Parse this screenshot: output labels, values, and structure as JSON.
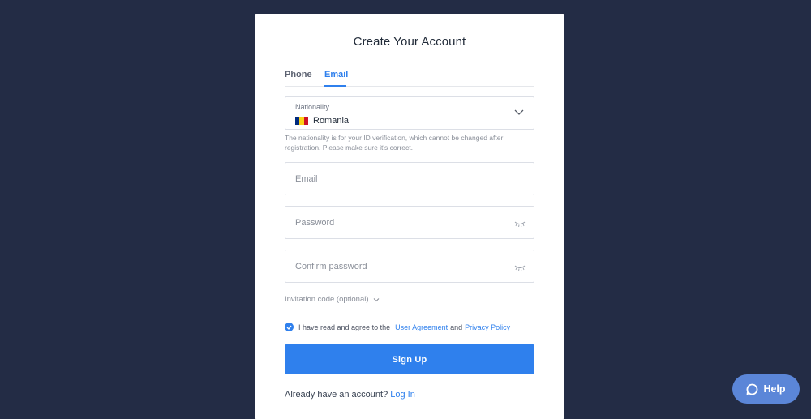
{
  "form": {
    "title": "Create Your Account",
    "tabs": [
      {
        "label": "Phone",
        "active": false
      },
      {
        "label": "Email",
        "active": true
      }
    ],
    "nationality": {
      "label": "Nationality",
      "value": "Romania",
      "flag_colors": [
        "#002b7f",
        "#fcd116",
        "#ce1126"
      ],
      "icon": "chevron-down-icon"
    },
    "nationality_hint": "The nationality is for your ID verification, which cannot be changed after registration. Please make sure it's correct.",
    "email": {
      "placeholder": "Email",
      "value": ""
    },
    "password": {
      "placeholder": "Password",
      "value": "",
      "icon": "eye-closed-icon"
    },
    "confirm_password": {
      "placeholder": "Confirm password",
      "value": "",
      "icon": "eye-closed-icon"
    },
    "invitation_code_label": "Invitation code (optional)",
    "agreement": {
      "checked": true,
      "prefix": "I have read and agree to the",
      "user_agreement": "User Agreement",
      "and": "and",
      "privacy_policy": "Privacy Policy"
    },
    "signup_label": "Sign Up",
    "login_prompt": "Already have an account?",
    "login_link": "Log In"
  },
  "help_button": {
    "label": "Help",
    "icon": "chat-bubble-icon"
  },
  "colors": {
    "accent": "#2f80ed",
    "background": "#232c45",
    "help": "#5b86d8"
  }
}
